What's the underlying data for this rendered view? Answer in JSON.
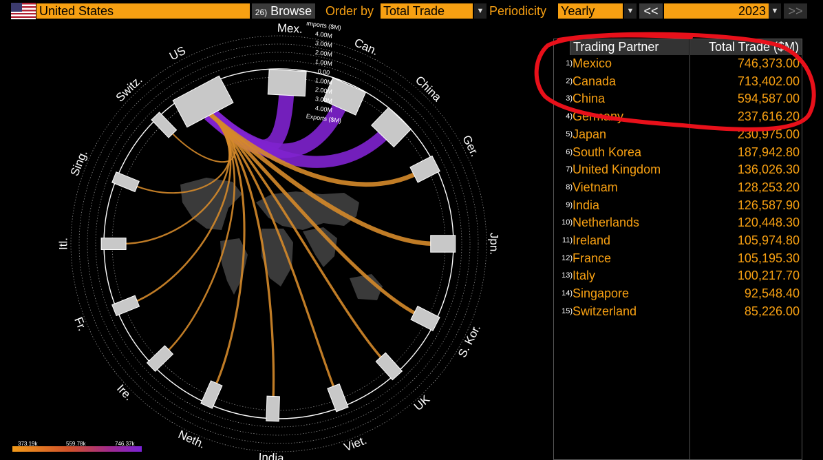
{
  "toolbar": {
    "country": "United States",
    "browse_num": "26)",
    "browse_label": "Browse",
    "order_label": "Order by",
    "order_value": "Total Trade",
    "periodicity_label": "Periodicity",
    "periodicity_value": "Yearly",
    "prev_label": "<<",
    "year": "2023",
    "next_label": ">>",
    "dropdown_glyph": "▼"
  },
  "chart": {
    "partners": [
      "Mex.",
      "Can.",
      "China",
      "Ger.",
      "Jpn.",
      "S. Kor.",
      "UK",
      "Viet.",
      "India",
      "Neth.",
      "Ire.",
      "Fr.",
      "Itl.",
      "Sing.",
      "Switz."
    ],
    "home": "US",
    "scale_labels": [
      "Imports ($M)",
      "4.00M",
      "3.00M",
      "2.00M",
      "1.00M",
      "0.00",
      "1.00M",
      "2.00M",
      "3.00M",
      "4.00M",
      "Exports ($M)"
    ],
    "legend": [
      "373.19k",
      "559.78k",
      "746.37k"
    ],
    "colors": {
      "low": "#f29a1a",
      "mid": "#c8305a",
      "high": "#7a22d6"
    }
  },
  "table": {
    "headers": [
      "Trading Partner",
      "Total Trade ($M)"
    ],
    "rows": [
      {
        "num": "1)",
        "name": "Mexico",
        "value": "746,373.00"
      },
      {
        "num": "2)",
        "name": "Canada",
        "value": "713,402.00"
      },
      {
        "num": "3)",
        "name": "China",
        "value": "594,587.00"
      },
      {
        "num": "4)",
        "name": "Germany",
        "value": "237,616.20"
      },
      {
        "num": "5)",
        "name": "Japan",
        "value": "230,975.00"
      },
      {
        "num": "6)",
        "name": "South Korea",
        "value": "187,942.80"
      },
      {
        "num": "7)",
        "name": "United Kingdom",
        "value": "136,026.30"
      },
      {
        "num": "8)",
        "name": "Vietnam",
        "value": "128,253.20"
      },
      {
        "num": "9)",
        "name": "India",
        "value": "126,587.90"
      },
      {
        "num": "10)",
        "name": "Netherlands",
        "value": "120,448.30"
      },
      {
        "num": "11)",
        "name": "Ireland",
        "value": "105,974.80"
      },
      {
        "num": "12)",
        "name": "France",
        "value": "105,195.30"
      },
      {
        "num": "13)",
        "name": "Italy",
        "value": "100,217.70"
      },
      {
        "num": "14)",
        "name": "Singapore",
        "value": "92,548.40"
      },
      {
        "num": "15)",
        "name": "Switzerland",
        "value": "85,226.00"
      }
    ]
  }
}
